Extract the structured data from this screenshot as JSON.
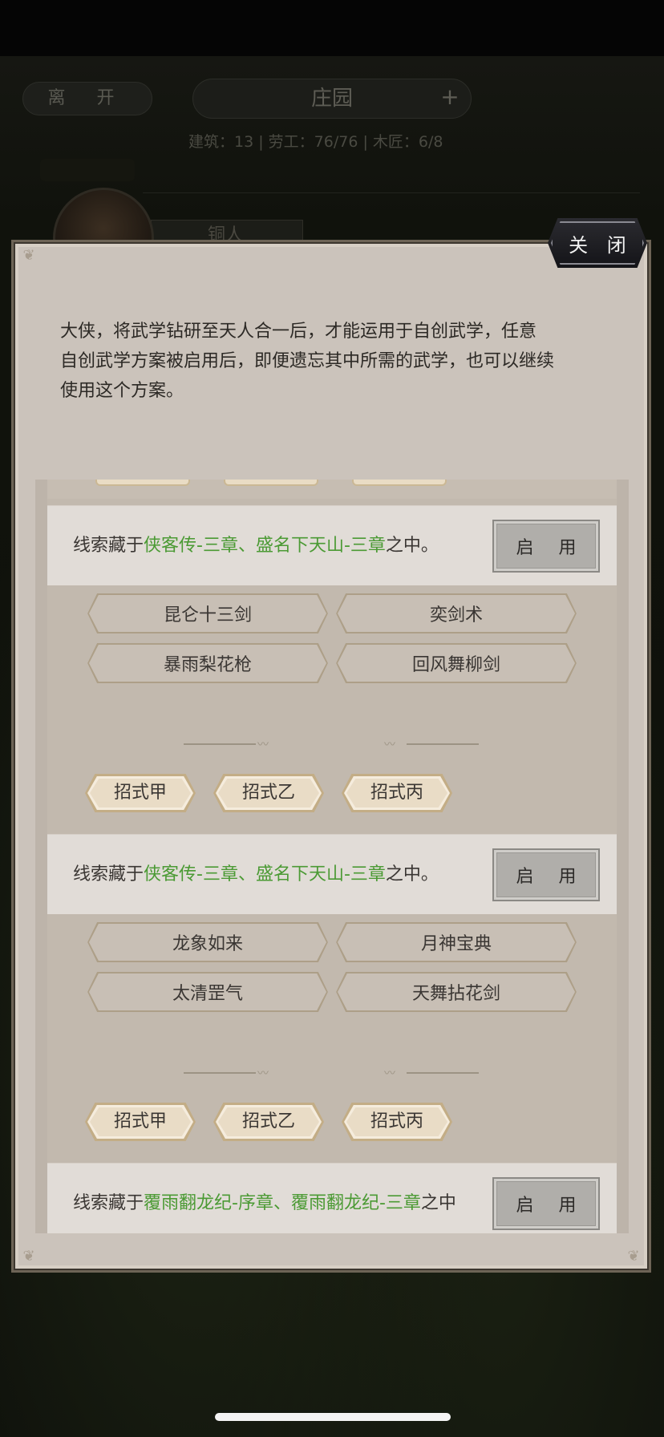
{
  "background": {
    "leave_label": "离 开",
    "title": "庄园",
    "plus": "+",
    "stats": "建筑：13 | 劳工：76/76 | 木匠：6/8",
    "sub_label": "",
    "avatar_tab_label": "铜人"
  },
  "modal": {
    "close_label": "关 闭",
    "intro_lines": [
      "大侠，将武学钻研至天人合一后，才能运用于自创武学，任意",
      "自创武学方案被启用后，即便遗忘其中所需的武学，也可以继续",
      "使用这个方案。"
    ],
    "enable_label": "启 用",
    "clue_prefix": "线索藏于",
    "clue_suffix": "之中。",
    "clue_suffix_cut": "之中",
    "plans": [
      {
        "clue_green": "侠客传-三章、盛名下天山-三章",
        "skills": [
          "昆仑十三剑",
          "奕剑术",
          "暴雨梨花枪",
          "回风舞柳剑"
        ],
        "stances": [
          "招式甲",
          "招式乙",
          "招式丙"
        ]
      },
      {
        "clue_green": "侠客传-三章、盛名下天山-三章",
        "skills": [
          "龙象如来",
          "月神宝典",
          "太清罡气",
          "天舞拈花剑"
        ],
        "stances": [
          "招式甲",
          "招式乙",
          "招式丙"
        ]
      },
      {
        "clue_green": "覆雨翻龙纪-序章、覆雨翻龙纪-三章"
      }
    ]
  },
  "colors": {
    "clue_highlight": "#4b9a34",
    "panel": "#cbc3bb",
    "close_button": "#1c1c20"
  }
}
